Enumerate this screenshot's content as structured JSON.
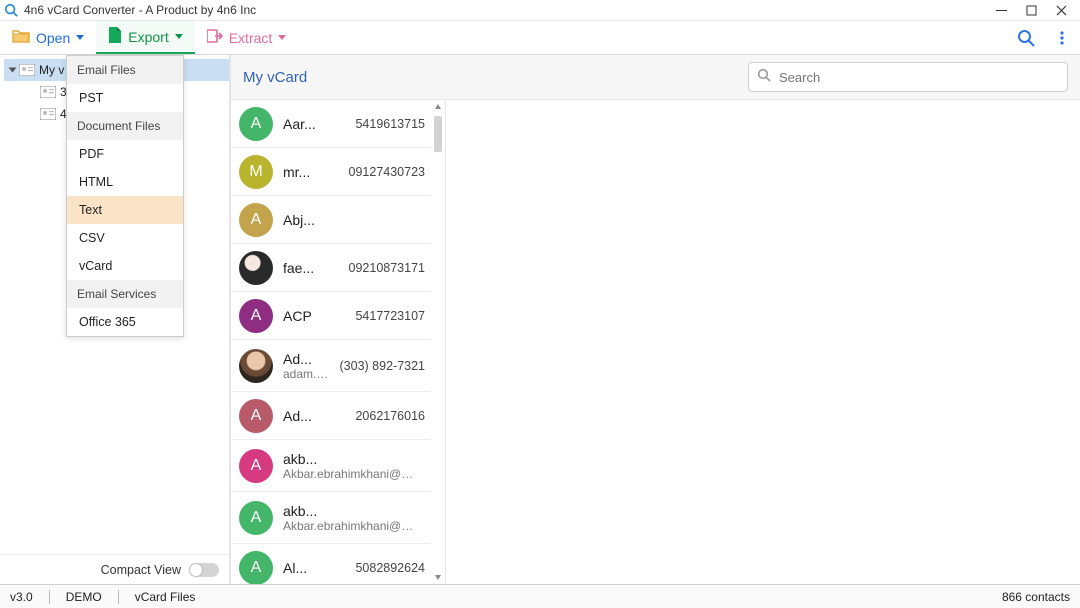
{
  "window": {
    "title": "4n6 vCard Converter - A Product by 4n6 Inc"
  },
  "toolbar": {
    "open": "Open",
    "export": "Export",
    "extract": "Extract"
  },
  "export_menu": {
    "headers": {
      "email": "Email Files",
      "doc": "Document Files",
      "svc": "Email Services"
    },
    "items": {
      "pst": "PST",
      "pdf": "PDF",
      "html": "HTML",
      "text": "Text",
      "csv": "CSV",
      "vcard": "vCard",
      "o365": "Office 365"
    }
  },
  "tree": {
    "root": "My v",
    "child_a": "3",
    "child_b": "4"
  },
  "compact_label": "Compact View",
  "main": {
    "title": "My vCard",
    "search_placeholder": "Search"
  },
  "contacts": [
    {
      "initial": "A",
      "color": "#43b66a",
      "name": "Aar...",
      "phone": "5419613715"
    },
    {
      "initial": "M",
      "color": "#b8b42d",
      "name": "mr...",
      "phone": "09127430723"
    },
    {
      "initial": "A",
      "color": "#c3a34c",
      "name": "Abj...",
      "phone": ""
    },
    {
      "initial": "",
      "color": "img1",
      "name": "fae...",
      "phone": "09210873171"
    },
    {
      "initial": "A",
      "color": "#8e2d82",
      "name": "ACP",
      "phone": "5417723107"
    },
    {
      "initial": "",
      "color": "img2",
      "name": "Ad...",
      "phone": "(303) 892-7321",
      "email": "adam.cohen@dgslaw.com"
    },
    {
      "initial": "A",
      "color": "#b95a6b",
      "name": "Ad...",
      "phone": "2062176016"
    },
    {
      "initial": "A",
      "color": "#d63b82",
      "name": "akb...",
      "phone": "",
      "email": "Akbar.ebrahimkhani@gmail.co"
    },
    {
      "initial": "A",
      "color": "#43b66a",
      "name": "akb...",
      "phone": "",
      "email": "Akbar.ebrahimkhani@gmail.co"
    },
    {
      "initial": "A",
      "color": "#43b66a",
      "name": "Al...",
      "phone": "5082892624"
    }
  ],
  "status": {
    "version": "v3.0",
    "mode": "DEMO",
    "context": "vCard Files",
    "right": "866 contacts"
  }
}
